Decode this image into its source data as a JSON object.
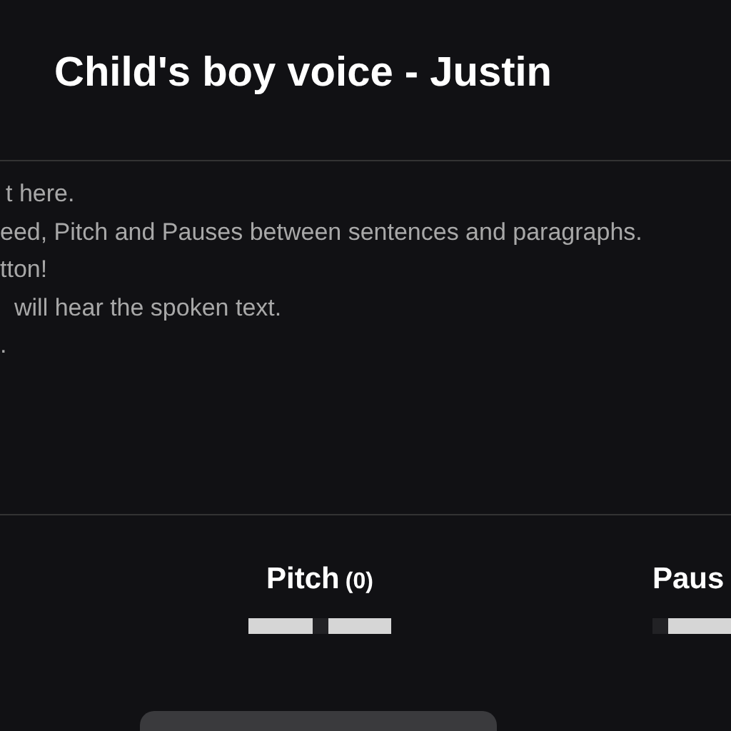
{
  "title": "Child's boy voice - Justin",
  "instructions": [
    "t here.",
    "eed, Pitch and Pauses between sentences and paragraphs.",
    "tton!",
    "will hear the spoken text.",
    "."
  ],
  "controls": [
    {
      "label": "Pitch",
      "value": "(0)",
      "level": 0.5
    },
    {
      "label": "Paus",
      "level": 0
    }
  ],
  "voice_button": {
    "kind": "button"
  }
}
